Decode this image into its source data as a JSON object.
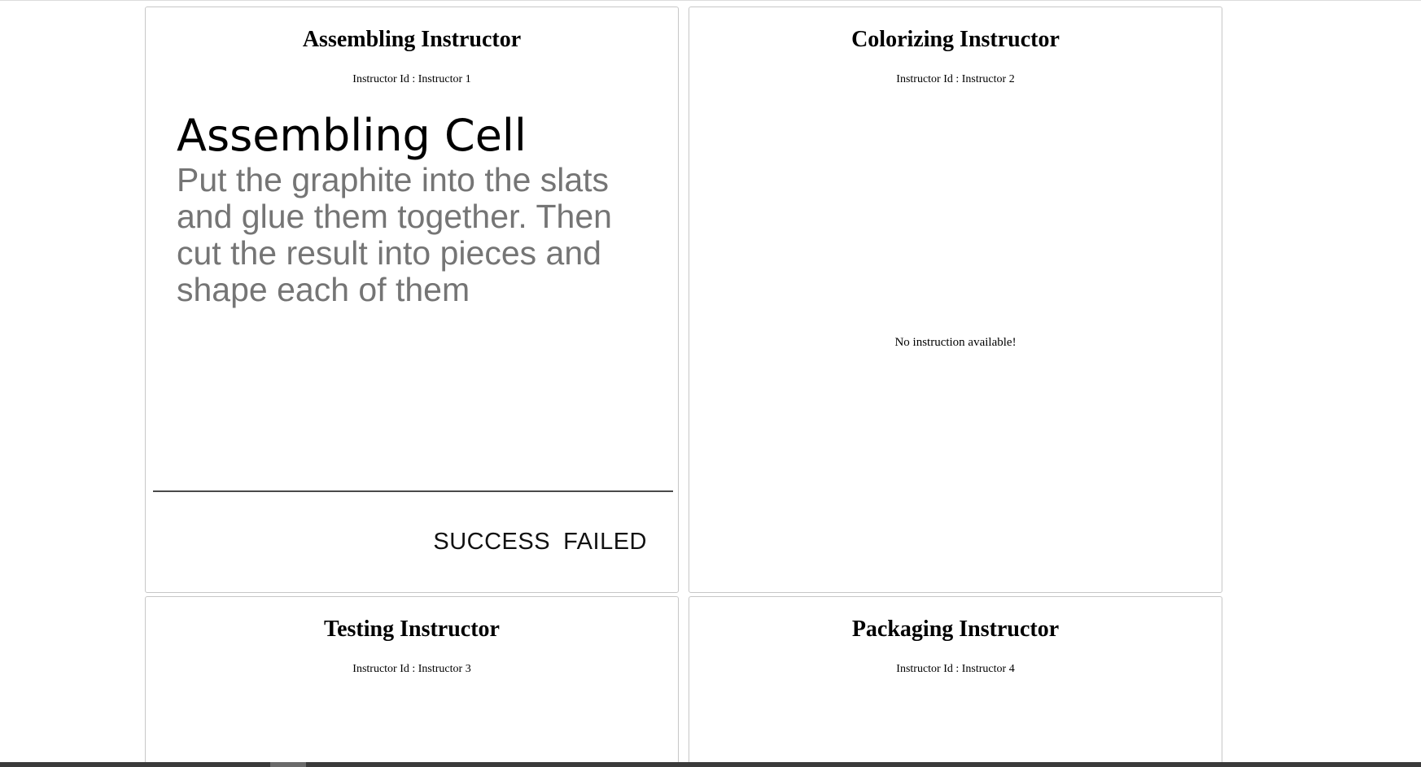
{
  "instructors": [
    {
      "title": "Assembling Instructor",
      "id_line": "Instructor Id : Instructor 1",
      "instruction": {
        "heading": "Assembling Cell",
        "text": "Put the graphite into the slats and glue them together. Then cut the result into pieces and shape each of them"
      },
      "actions": {
        "success_label": "SUCCESS",
        "failed_label": "FAILED"
      }
    },
    {
      "title": "Colorizing Instructor",
      "id_line": "Instructor Id : Instructor 2",
      "message": "No instruction available!"
    },
    {
      "title": "Testing Instructor",
      "id_line": "Instructor Id : Instructor 3"
    },
    {
      "title": "Packaging Instructor",
      "id_line": "Instructor Id : Instructor 4"
    }
  ],
  "colors": {
    "card_border": "#c7c7c7",
    "instruction_text": "#757575",
    "divider": "#4a4a4a"
  }
}
